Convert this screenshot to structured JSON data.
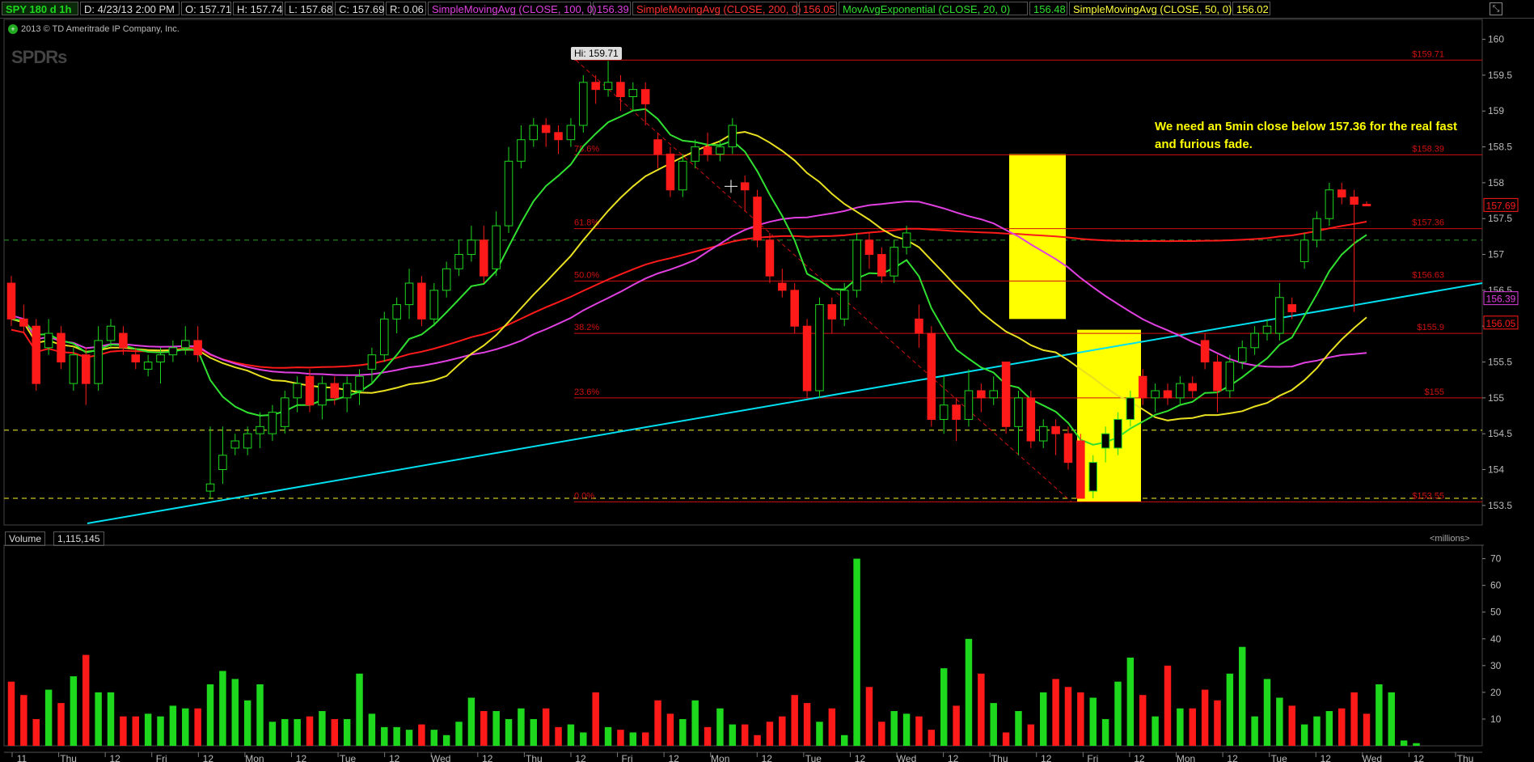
{
  "header": {
    "symbol": "SPY 180 d 1h",
    "date": "D: 4/23/13 2:00 PM",
    "open": "O: 157.71",
    "high": "H: 157.74",
    "low": "L: 157.68",
    "close": "C: 157.69",
    "range": "R: 0.06",
    "studies": [
      {
        "label": "SimpleMovingAvg (CLOSE, 100, 0)",
        "value": "156.39",
        "color": "#e040e0"
      },
      {
        "label": "SimpleMovingAvg (CLOSE, 200, 0)",
        "value": "156.05",
        "color": "#ff3030"
      },
      {
        "label": "MovAvgExponential (CLOSE, 20, 0)",
        "value": "156.48",
        "color": "#30e030"
      },
      {
        "label": "SimpleMovingAvg (CLOSE, 50, 0)",
        "value": "156.02",
        "color": "#ffff40"
      }
    ]
  },
  "copyright": "2013 © TD Ameritrade IP Company, Inc.",
  "logo_text": "SPDRs",
  "annotation": "We need an 5min close below 157.36 for the real fast and furious fade.",
  "hi_label": "Hi: 159.71",
  "volume": {
    "label": "Volume",
    "value": "1,115,145",
    "units": "<millions>"
  },
  "colors": {
    "up": "#1ed81e",
    "down": "#ff1a1a",
    "fib": "#d01010",
    "trend": "#00e0f0",
    "highlight": "#ffff00"
  },
  "chart_data": [
    {
      "type": "candlestick",
      "title": "SPY 180 d 1h",
      "y_axis_ticks": [
        153.5,
        154,
        154.5,
        155,
        155.5,
        156,
        156.5,
        157,
        157.5,
        158,
        158.5,
        159,
        159.5,
        160
      ],
      "ylim": [
        153.25,
        160.3
      ],
      "x_labels": [
        "11",
        "Thu",
        "12",
        "Fri",
        "12",
        "Mon",
        "12",
        "Tue",
        "12",
        "Wed",
        "12",
        "Thu",
        "12",
        "Fri",
        "12",
        "Mon",
        "12",
        "Tue",
        "12",
        "Wed",
        "12",
        "Thu",
        "12",
        "Fri",
        "12",
        "Mon",
        "12",
        "Tue",
        "12",
        "Wed",
        "12",
        "Thu"
      ],
      "price_tags": [
        {
          "value": 157.69,
          "label": "157.69",
          "color": "#ff1a1a"
        },
        {
          "value": 156.39,
          "label": "156.39",
          "color": "#e040e0"
        },
        {
          "value": 156.05,
          "label": "156.05",
          "color": "#ff1a1a"
        }
      ],
      "fibonacci": [
        {
          "label": "0.0%",
          "price": "$153.55",
          "value": 153.55
        },
        {
          "label": "23.6%",
          "price": "$155",
          "value": 155.0
        },
        {
          "label": "38.2%",
          "price": "$155.9",
          "value": 155.9
        },
        {
          "label": "50.0%",
          "price": "$156.63",
          "value": 156.63
        },
        {
          "label": "61.8%",
          "price": "$157.36",
          "value": 157.36
        },
        {
          "label": "78.6%",
          "price": "$158.39",
          "value": 158.39
        },
        {
          "label": "",
          "price": "$159.71",
          "value": 159.71
        }
      ],
      "candles": [
        [
          156.6,
          156.1,
          156.7,
          156.0
        ],
        [
          156.1,
          156.0,
          156.3,
          155.9
        ],
        [
          156.0,
          155.2,
          156.1,
          155.1
        ],
        [
          155.7,
          155.9,
          156.1,
          155.6
        ],
        [
          155.9,
          155.5,
          156.0,
          155.4
        ],
        [
          155.2,
          155.6,
          155.7,
          155.1
        ],
        [
          155.6,
          155.2,
          155.7,
          154.9
        ],
        [
          155.2,
          155.8,
          156.0,
          155.1
        ],
        [
          155.8,
          156.0,
          156.1,
          155.7
        ],
        [
          155.9,
          155.7,
          156.0,
          155.6
        ],
        [
          155.6,
          155.5,
          155.7,
          155.4
        ],
        [
          155.4,
          155.5,
          155.6,
          155.3
        ],
        [
          155.5,
          155.6,
          155.7,
          155.2
        ],
        [
          155.6,
          155.7,
          155.8,
          155.5
        ],
        [
          155.7,
          155.8,
          156.0,
          155.6
        ],
        [
          155.8,
          155.6,
          156.0,
          155.5
        ],
        [
          153.7,
          153.8,
          154.6,
          153.6
        ],
        [
          154.0,
          154.2,
          154.6,
          153.8
        ],
        [
          154.3,
          154.4,
          154.5,
          154.2
        ],
        [
          154.3,
          154.5,
          154.6,
          154.2
        ],
        [
          154.5,
          154.6,
          154.8,
          154.3
        ],
        [
          154.5,
          154.8,
          154.9,
          154.4
        ],
        [
          154.6,
          155.0,
          155.1,
          154.5
        ],
        [
          155.0,
          155.2,
          155.3,
          154.8
        ],
        [
          155.3,
          154.9,
          155.4,
          154.8
        ],
        [
          154.9,
          155.2,
          155.3,
          154.7
        ],
        [
          155.2,
          155.0,
          155.3,
          154.9
        ],
        [
          155.0,
          155.2,
          155.3,
          154.8
        ],
        [
          155.1,
          155.3,
          155.4,
          154.9
        ],
        [
          155.4,
          155.6,
          155.7,
          155.2
        ],
        [
          155.6,
          156.1,
          156.2,
          155.5
        ],
        [
          156.1,
          156.3,
          156.4,
          155.9
        ],
        [
          156.3,
          156.6,
          156.8,
          156.1
        ],
        [
          156.6,
          156.1,
          156.7,
          156.0
        ],
        [
          156.1,
          156.5,
          156.6,
          156.0
        ],
        [
          156.5,
          156.8,
          156.9,
          156.4
        ],
        [
          156.8,
          157.0,
          157.2,
          156.7
        ],
        [
          157.0,
          157.2,
          157.4,
          156.9
        ],
        [
          157.2,
          156.7,
          157.4,
          156.6
        ],
        [
          156.8,
          157.4,
          157.6,
          156.7
        ],
        [
          157.4,
          158.3,
          158.5,
          157.3
        ],
        [
          158.3,
          158.6,
          158.8,
          158.2
        ],
        [
          158.6,
          158.8,
          158.9,
          158.5
        ],
        [
          158.8,
          158.7,
          158.9,
          158.5
        ],
        [
          158.7,
          158.6,
          158.8,
          158.4
        ],
        [
          158.6,
          158.8,
          158.9,
          158.5
        ],
        [
          158.8,
          159.4,
          159.5,
          158.7
        ],
        [
          159.4,
          159.3,
          159.5,
          159.1
        ],
        [
          159.3,
          159.4,
          159.7,
          159.2
        ],
        [
          159.4,
          159.2,
          159.5,
          159.0
        ],
        [
          159.2,
          159.3,
          159.4,
          159.0
        ],
        [
          159.3,
          159.1,
          159.4,
          158.8
        ],
        [
          158.6,
          158.4,
          158.7,
          158.2
        ],
        [
          158.4,
          157.9,
          158.5,
          157.8
        ],
        [
          157.9,
          158.3,
          158.4,
          157.8
        ],
        [
          158.3,
          158.5,
          158.6,
          158.2
        ],
        [
          158.5,
          158.4,
          158.7,
          158.3
        ],
        [
          158.4,
          158.5,
          158.6,
          158.3
        ],
        [
          158.5,
          158.8,
          158.9,
          158.4
        ],
        [
          158.0,
          157.9,
          158.1,
          157.6
        ],
        [
          157.8,
          157.2,
          157.9,
          157.1
        ],
        [
          157.2,
          156.7,
          157.3,
          156.6
        ],
        [
          156.6,
          156.5,
          156.8,
          156.4
        ],
        [
          156.5,
          156.0,
          156.6,
          155.9
        ],
        [
          156.0,
          155.1,
          156.1,
          155.0
        ],
        [
          155.1,
          156.3,
          156.4,
          155.0
        ],
        [
          156.3,
          156.1,
          156.4,
          155.9
        ],
        [
          156.1,
          156.5,
          156.6,
          156.0
        ],
        [
          156.5,
          157.2,
          157.3,
          156.4
        ],
        [
          157.2,
          157.0,
          157.3,
          156.8
        ],
        [
          157.0,
          156.7,
          157.1,
          156.6
        ],
        [
          156.7,
          157.1,
          157.2,
          156.6
        ],
        [
          157.1,
          157.3,
          157.4,
          157.0
        ],
        [
          156.1,
          155.9,
          156.3,
          155.7
        ],
        [
          155.9,
          154.7,
          156.0,
          154.6
        ],
        [
          154.7,
          154.9,
          155.3,
          154.5
        ],
        [
          154.9,
          154.7,
          155.0,
          154.4
        ],
        [
          154.7,
          155.1,
          155.4,
          154.6
        ],
        [
          155.1,
          155.0,
          155.2,
          154.8
        ],
        [
          155.0,
          155.1,
          155.3,
          154.9
        ],
        [
          155.5,
          154.6,
          155.5,
          154.5
        ],
        [
          154.6,
          155.0,
          155.1,
          154.2
        ],
        [
          155.0,
          154.4,
          155.1,
          154.3
        ],
        [
          154.4,
          154.6,
          154.7,
          154.3
        ],
        [
          154.6,
          154.5,
          154.7,
          154.2
        ],
        [
          154.5,
          154.1,
          154.6,
          154.0
        ],
        [
          154.4,
          153.6,
          154.5,
          153.6
        ],
        [
          153.7,
          154.1,
          154.2,
          153.6
        ],
        [
          154.3,
          154.5,
          154.6,
          154.1
        ],
        [
          154.3,
          154.7,
          154.8,
          154.2
        ],
        [
          154.7,
          155.0,
          155.1,
          154.6
        ],
        [
          155.3,
          155.0,
          155.4,
          154.9
        ],
        [
          155.0,
          155.1,
          155.2,
          154.8
        ],
        [
          155.1,
          155.0,
          155.2,
          154.9
        ],
        [
          155.0,
          155.2,
          155.3,
          154.9
        ],
        [
          155.2,
          155.1,
          155.3,
          155.0
        ],
        [
          155.8,
          155.5,
          155.9,
          155.4
        ],
        [
          155.5,
          155.1,
          155.6,
          154.8
        ],
        [
          155.1,
          155.5,
          155.6,
          155.0
        ],
        [
          155.5,
          155.7,
          155.8,
          155.4
        ],
        [
          155.7,
          155.9,
          156.0,
          155.6
        ],
        [
          155.9,
          156.0,
          156.1,
          155.8
        ],
        [
          155.9,
          156.4,
          156.6,
          155.8
        ],
        [
          156.3,
          156.2,
          156.4,
          156.1
        ],
        [
          156.9,
          157.2,
          157.3,
          156.8
        ],
        [
          157.2,
          157.5,
          157.6,
          157.1
        ],
        [
          157.5,
          157.9,
          158.0,
          157.4
        ],
        [
          157.9,
          157.8,
          158.0,
          157.7
        ],
        [
          157.8,
          157.7,
          157.9,
          156.2
        ],
        [
          157.7,
          157.69,
          157.74,
          157.68
        ]
      ],
      "volume_ticks": [
        10,
        20,
        30,
        40,
        50,
        60,
        70
      ],
      "volume_ylim": [
        0,
        72
      ],
      "volume_millions": [
        24,
        19,
        10,
        21,
        16,
        26,
        34,
        20,
        20,
        11,
        11,
        12,
        11,
        15,
        14,
        14,
        23,
        28,
        25,
        17,
        23,
        9,
        10,
        10,
        11,
        13,
        10,
        10,
        27,
        12,
        7,
        7,
        6,
        8,
        6,
        4,
        9,
        18,
        13,
        13,
        10,
        14,
        10,
        14,
        7,
        8,
        5,
        20,
        7,
        6,
        5,
        5,
        17,
        12,
        10,
        17,
        7,
        14,
        8,
        8,
        4,
        9,
        11,
        19,
        16,
        9,
        14,
        4,
        70,
        22,
        9,
        13,
        12,
        11,
        6,
        29,
        15,
        40,
        27,
        16,
        5,
        13,
        8,
        20,
        25,
        22,
        20,
        18,
        10,
        24,
        33,
        19,
        11,
        30,
        14,
        14,
        21,
        17,
        27,
        37,
        11,
        25,
        18,
        15,
        8,
        11,
        13,
        14,
        20,
        12,
        23,
        20,
        2,
        1
      ]
    }
  ]
}
